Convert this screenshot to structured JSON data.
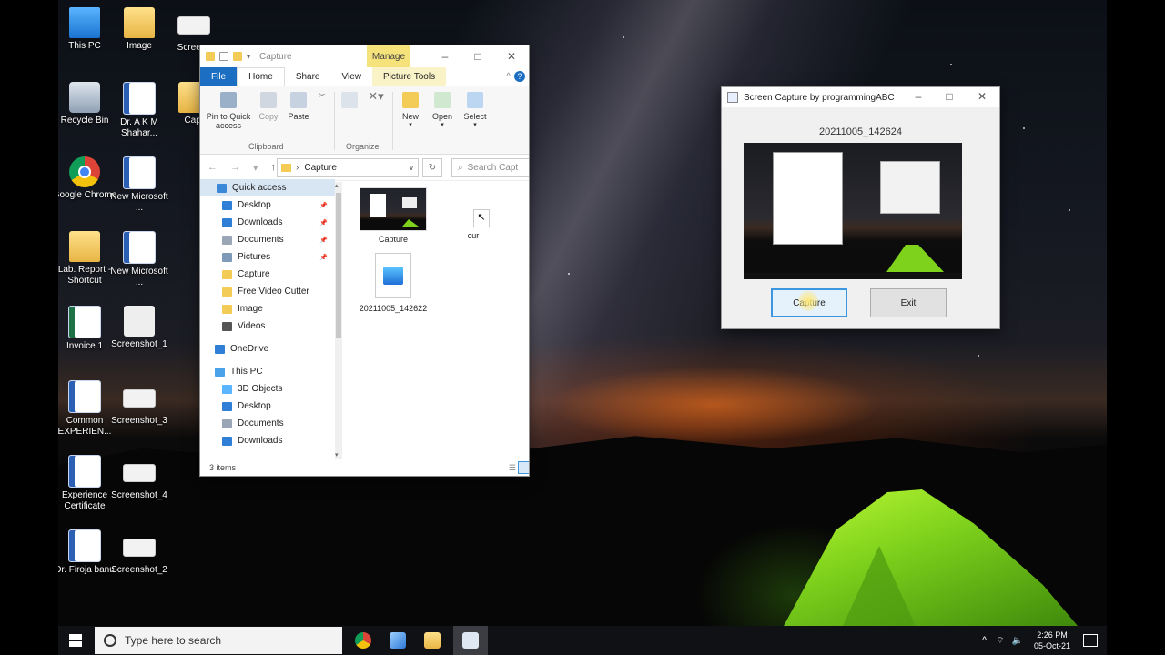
{
  "desktop_icons": [
    {
      "label": "This PC",
      "type": "pc"
    },
    {
      "label": "Image",
      "type": "folder"
    },
    {
      "label": "Screens",
      "type": "shot"
    },
    {
      "label": "Recycle Bin",
      "type": "bin"
    },
    {
      "label": "Dr. A K M Shahar...",
      "type": "doc"
    },
    {
      "label": "Capt",
      "type": "folder"
    },
    {
      "label": "Google Chrome",
      "type": "chrome"
    },
    {
      "label": "New Microsoft ...",
      "type": "doc"
    },
    {
      "label": "Lab. Report - Shortcut",
      "type": "folder"
    },
    {
      "label": "New Microsoft ...",
      "type": "doc"
    },
    {
      "label": "Invoice 1",
      "type": "xls"
    },
    {
      "label": "Screenshot_1",
      "type": "hands"
    },
    {
      "label": "Common EXPERIEN...",
      "type": "doc"
    },
    {
      "label": "Screenshot_3",
      "type": "shot"
    },
    {
      "label": "Experience Certificate",
      "type": "doc"
    },
    {
      "label": "Screenshot_4",
      "type": "shot"
    },
    {
      "label": "Dr. Firoja banu",
      "type": "doc"
    },
    {
      "label": "Screenshot_2",
      "type": "shot"
    }
  ],
  "explorer": {
    "title": "Capture",
    "manage_label": "Manage",
    "tabs": {
      "file": "File",
      "home": "Home",
      "share": "Share",
      "view": "View",
      "picture_tools": "Picture Tools"
    },
    "ribbon": {
      "pin": "Pin to Quick access",
      "copy": "Copy",
      "paste": "Paste",
      "new": "New",
      "open": "Open",
      "select": "Select",
      "group_clipboard": "Clipboard",
      "group_organize": "Organize"
    },
    "address_path": "Capture",
    "search_placeholder": "Search Capt",
    "nav_items": [
      {
        "label": "Quick access",
        "pinned": false,
        "color": "#3b87d8"
      },
      {
        "label": "Desktop",
        "pinned": true,
        "color": "#2f7fd6"
      },
      {
        "label": "Downloads",
        "pinned": true,
        "color": "#2f7fd6"
      },
      {
        "label": "Documents",
        "pinned": true,
        "color": "#9aa6b6"
      },
      {
        "label": "Pictures",
        "pinned": true,
        "color": "#7f9ab8"
      },
      {
        "label": "Capture",
        "pinned": false,
        "color": "#f3cb57"
      },
      {
        "label": "Free Video Cutter",
        "pinned": false,
        "color": "#f3cb57"
      },
      {
        "label": "Image",
        "pinned": false,
        "color": "#f3cb57"
      },
      {
        "label": "Videos",
        "pinned": false,
        "color": "#555"
      },
      {
        "label": "OneDrive",
        "pinned": false,
        "color": "#2f7fd6"
      },
      {
        "label": "This PC",
        "pinned": false,
        "color": "#4aa3e8"
      },
      {
        "label": "3D Objects",
        "pinned": false,
        "color": "#5ab4ff"
      },
      {
        "label": "Desktop",
        "pinned": false,
        "color": "#2f7fd6"
      },
      {
        "label": "Documents",
        "pinned": false,
        "color": "#9aa6b6"
      },
      {
        "label": "Downloads",
        "pinned": false,
        "color": "#2f7fd6"
      }
    ],
    "pin_glyph": "📌",
    "files": [
      {
        "name": "Capture"
      },
      {
        "name": "cur"
      },
      {
        "name": "20211005_142622"
      }
    ],
    "status": "3 items"
  },
  "capture_app": {
    "title": "Screen Capture by programmingABC",
    "filename": "20211005_142624",
    "capture_label": "Capture",
    "exit_label": "Exit"
  },
  "taskbar": {
    "search_placeholder": "Type here to search",
    "time": "2:26 PM",
    "date": "05-Oct-21"
  }
}
